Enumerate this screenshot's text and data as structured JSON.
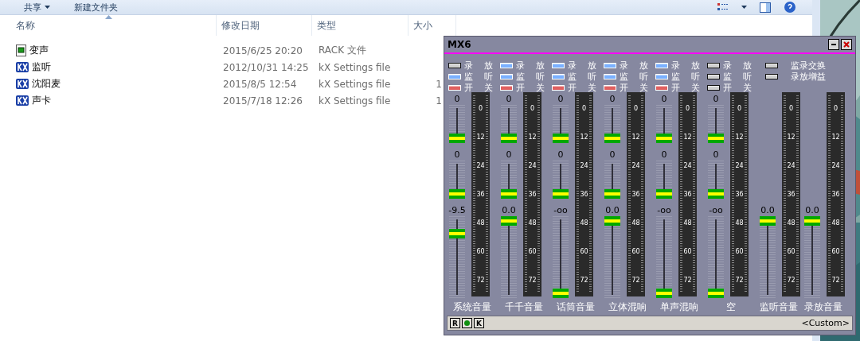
{
  "toolbar": {
    "items": [
      {
        "label": "共享",
        "dropdown": true
      },
      {
        "label": "新建文件夹",
        "dropdown": false
      }
    ]
  },
  "columns": [
    {
      "label": "名称",
      "sorted": true
    },
    {
      "label": "修改日期",
      "sorted": false
    },
    {
      "label": "类型",
      "sorted": false
    },
    {
      "label": "大小",
      "sorted": false
    }
  ],
  "files": [
    {
      "kind": "rack",
      "name": "变声",
      "modified": "2015/6/25 20:20",
      "type": "RACK 文件"
    },
    {
      "kind": "kx",
      "name": "监听",
      "modified": "2012/10/31 14:25",
      "type": "kX Settings file"
    },
    {
      "kind": "kx",
      "name": "沈阳麦",
      "modified": "2015/8/5 12:54",
      "type": "kX Settings file",
      "size": "1"
    },
    {
      "kind": "kx",
      "name": "声卡",
      "modified": "2015/7/18 12:26",
      "type": "kX Settings file",
      "size": "1"
    }
  ],
  "mixer": {
    "title": "MX6",
    "inputs": [
      {
        "name": "系统音量",
        "switches": [
          {
            "kind": "record",
            "on": false,
            "labels": [
              "录",
              "放"
            ]
          },
          {
            "kind": "monitor",
            "on": true,
            "labels": [
              "监",
              "听"
            ]
          },
          {
            "kind": "power",
            "on": true,
            "labels": [
              "开",
              "关"
            ]
          }
        ],
        "faders": [
          {
            "reading": "0",
            "level": 0
          },
          {
            "reading": "0",
            "level": 0
          },
          {
            "reading": "-9.5",
            "level": 0.82
          }
        ],
        "meter_scale": [
          "0",
          "12",
          "24",
          "36",
          "48",
          "60",
          "72"
        ]
      },
      {
        "name": "千千音量",
        "switches": [
          {
            "kind": "record",
            "on": true,
            "labels": [
              "录",
              "放"
            ]
          },
          {
            "kind": "monitor",
            "on": true,
            "labels": [
              "监",
              "听"
            ]
          },
          {
            "kind": "power",
            "on": true,
            "labels": [
              "开",
              "关"
            ]
          }
        ],
        "faders": [
          {
            "reading": "0",
            "level": 0
          },
          {
            "reading": "0",
            "level": 0
          },
          {
            "reading": "0.0",
            "level": 1
          }
        ],
        "meter_scale": [
          "0",
          "12",
          "24",
          "36",
          "48",
          "60",
          "72"
        ]
      },
      {
        "name": "话筒音量",
        "switches": [
          {
            "kind": "record",
            "on": true,
            "labels": [
              "录",
              "放"
            ]
          },
          {
            "kind": "monitor",
            "on": true,
            "labels": [
              "监",
              "听"
            ]
          },
          {
            "kind": "power",
            "on": true,
            "labels": [
              "开",
              "关"
            ]
          }
        ],
        "faders": [
          {
            "reading": "0",
            "level": 0
          },
          {
            "reading": "0",
            "level": 0
          },
          {
            "reading": "-oo",
            "level": 0
          }
        ],
        "meter_scale": [
          "0",
          "12",
          "24",
          "36",
          "48",
          "60",
          "72"
        ]
      },
      {
        "name": "立体混响",
        "switches": [
          {
            "kind": "record",
            "on": true,
            "labels": [
              "录",
              "放"
            ]
          },
          {
            "kind": "monitor",
            "on": true,
            "labels": [
              "监",
              "听"
            ]
          },
          {
            "kind": "power",
            "on": true,
            "labels": [
              "开",
              "关"
            ]
          }
        ],
        "faders": [
          {
            "reading": "0",
            "level": 0
          },
          {
            "reading": "0",
            "level": 0
          },
          {
            "reading": "0.0",
            "level": 1
          }
        ],
        "meter_scale": [
          "0",
          "12",
          "24",
          "36",
          "48",
          "60",
          "72"
        ]
      },
      {
        "name": "单声混响",
        "switches": [
          {
            "kind": "record",
            "on": true,
            "labels": [
              "录",
              "放"
            ]
          },
          {
            "kind": "monitor",
            "on": true,
            "labels": [
              "监",
              "听"
            ]
          },
          {
            "kind": "power",
            "on": true,
            "labels": [
              "开",
              "关"
            ]
          }
        ],
        "faders": [
          {
            "reading": "0",
            "level": 0
          },
          {
            "reading": "0",
            "level": 0
          },
          {
            "reading": "-oo",
            "level": 0
          }
        ],
        "meter_scale": [
          "0",
          "12",
          "24",
          "36",
          "48",
          "60",
          "72"
        ]
      },
      {
        "name": "空",
        "switches": [
          {
            "kind": "record",
            "on": false,
            "labels": [
              "录",
              "放"
            ]
          },
          {
            "kind": "monitor",
            "on": false,
            "labels": [
              "监",
              "听"
            ]
          },
          {
            "kind": "power",
            "on": false,
            "labels": [
              "开",
              "关"
            ]
          }
        ],
        "faders": [
          {
            "reading": "0",
            "level": 0
          },
          {
            "reading": "0",
            "level": 0
          },
          {
            "reading": "-oo",
            "level": 0
          }
        ],
        "meter_scale": [
          "0",
          "12",
          "24",
          "36",
          "48",
          "60",
          "72"
        ]
      }
    ],
    "switches": [
      {
        "label": "监录交换",
        "on": false
      },
      {
        "label": "录放增益",
        "on": false
      }
    ],
    "outputs": [
      {
        "name": "监听音量",
        "faders": [
          {
            "reading": "0.0",
            "level": 1
          }
        ],
        "meter_scale": [
          "0",
          "12",
          "24",
          "36",
          "48",
          "60",
          "72"
        ]
      },
      {
        "name": "录放音量",
        "faders": [
          {
            "reading": "0.0",
            "level": 1
          }
        ],
        "meter_scale": [
          "0",
          "12",
          "24",
          "36",
          "48",
          "60",
          "72"
        ]
      }
    ],
    "status": {
      "buttons": [
        {
          "kind": "letter",
          "label": "R"
        },
        {
          "kind": "dot"
        },
        {
          "kind": "letter",
          "label": "K"
        }
      ],
      "preset": "<Custom>"
    }
  }
}
